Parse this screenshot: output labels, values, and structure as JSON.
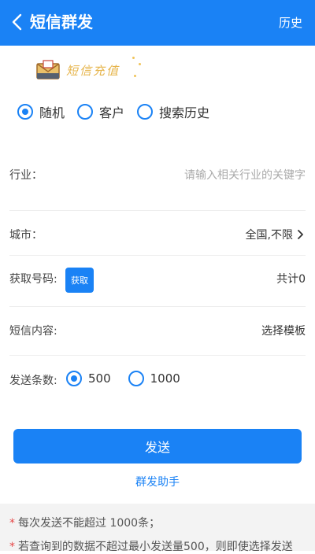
{
  "header": {
    "title": "短信群发",
    "history": "历史"
  },
  "banner": {
    "recharge_text": "短信充值"
  },
  "source_options": [
    {
      "label": "随机",
      "selected": true
    },
    {
      "label": "客户",
      "selected": false
    },
    {
      "label": "搜索历史",
      "selected": false
    }
  ],
  "form": {
    "industry": {
      "label": "行业：",
      "placeholder": "请输入相关行业的关键字"
    },
    "city": {
      "label": "城市：",
      "value": "全国,不限"
    },
    "numbers": {
      "label": "获取号码:",
      "button": "获取",
      "total": "共计0"
    },
    "content": {
      "label": "短信内容:",
      "template": "选择模板"
    },
    "count": {
      "label": "发送条数:",
      "options": [
        {
          "label": "500",
          "selected": true
        },
        {
          "label": "1000",
          "selected": false
        }
      ]
    }
  },
  "actions": {
    "send": "发送",
    "assistant": "群发助手"
  },
  "notes": [
    "每次发送不能超过 1000条；",
    "若查询到的数据不超过最小发送量500，则即使选择发送"
  ],
  "colors": {
    "primary": "#1a82f5",
    "note_star": "#e64646",
    "recharge": "#e6b44a"
  }
}
